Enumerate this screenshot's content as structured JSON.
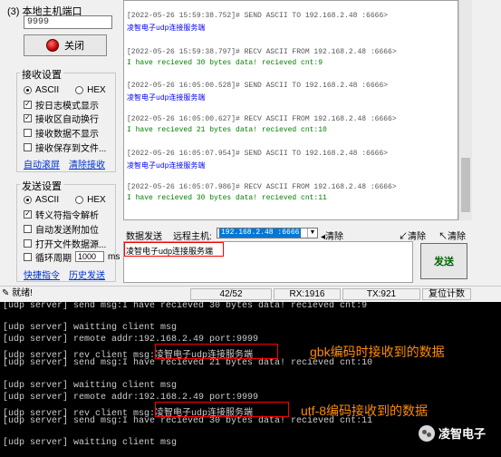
{
  "left_panel": {
    "conn_label": "(3) 本地主机端口",
    "port_value": "9999",
    "close_label": "关闭",
    "recv_group_title": "接收设置",
    "recv_ascii": "ASCII",
    "recv_hex": "HEX",
    "recv_opts": [
      "按日志模式显示",
      "接收区自动换行",
      "接收数据不显示",
      "接收保存到文件..."
    ],
    "recv_links": [
      "自动滚屏",
      "清除接收"
    ],
    "send_group_title": "发送设置",
    "send_ascii": "ASCII",
    "send_hex": "HEX",
    "send_opts": [
      "转义符指令解析",
      "自动发送附加位",
      "打开文件数据源...",
      "循环周期"
    ],
    "cycle_value": "1000",
    "cycle_unit": "ms",
    "send_links": [
      "快捷指令",
      "历史发送"
    ]
  },
  "log": [
    {
      "type": "send",
      "header": "[2022-05-26 15:59:38.752]# SEND ASCII TO 192.168.2.48 :6666>",
      "body": "凌智电子udp连接服务端"
    },
    {
      "type": "recv",
      "header": "[2022-05-26 15:59:38.797]# RECV ASCII FROM 192.168.2.48 :6666>",
      "body": "I have recieved 30 bytes data! recieved cnt:9"
    },
    {
      "type": "send",
      "header": "[2022-05-26 16:05:00.528]# SEND ASCII TO 192.168.2.48 :6666>",
      "body": "凌智电子udp连接服务端"
    },
    {
      "type": "recv",
      "header": "[2022-05-26 16:05:00.627]# RECV ASCII FROM 192.168.2.48 :6666>",
      "body": "I have recieved 21 bytes data! recieved cnt:10"
    },
    {
      "type": "send",
      "header": "[2022-05-26 16:05:07.954]# SEND ASCII TO 192.168.2.48 :6666>",
      "body": "凌智电子udp连接服务端"
    },
    {
      "type": "recv",
      "header": "[2022-05-26 16:05:07.986]# RECV ASCII FROM 192.168.2.48 :6666>",
      "body": "I have recieved 30 bytes data! recieved cnt:11"
    }
  ],
  "toolbar": {
    "data_send": "数据发送",
    "remote_host": "远程主机:",
    "host_value": "192.168.2.48 :6666",
    "clear1": "清除",
    "clear2": "清除",
    "clear3": "清除"
  },
  "send_box": {
    "text": "凌智电子udp连接服务端",
    "send_label": "发送"
  },
  "status": {
    "ready": "就绪!",
    "counter": "42/52",
    "rx": "RX:1916",
    "tx": "TX:921",
    "reset": "复位计数"
  },
  "terminal": [
    "[udp server] send msg:I have recieved 30 bytes data! recieved cnt:9",
    "[udp server] waitting client msg",
    "[udp server] remote addr:192.168.2.49 port:9999",
    "[udp server] rev client msg:凌智电子udp连接服务端",
    "[udp server] send msg:I have recieved 21 bytes data! recieved cnt:10",
    "[udp server] waitting client msg",
    "[udp server] remote addr:192.168.2.49 port:9999",
    "[udp server] rev client msg:凌智电子udp连接服务端",
    "[udp server] send msg:I have recieved 30 bytes data! recieved cnt:11",
    "[udp server] waitting client msg"
  ],
  "annotations": {
    "gbk": "gbk编码时接收到的数据",
    "utf8": "utf-8编码接收到的数据"
  },
  "watermark": "凌智电子",
  "colors": {
    "send_text": "#0000ff",
    "recv_text": "#008000",
    "annotation": "#ff8c00",
    "highlight_box": "#ff0000"
  }
}
